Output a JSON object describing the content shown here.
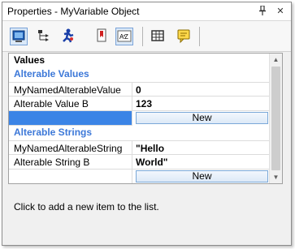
{
  "window": {
    "title": "Properties - MyVariable Object",
    "pin_glyph": "ᵽ",
    "close_glyph": "✕"
  },
  "toolbar": {
    "tools": [
      {
        "name": "properties-icon",
        "active": true
      },
      {
        "name": "hierarchy-icon",
        "active": false
      },
      {
        "name": "run-icon",
        "active": false
      },
      {
        "name": "bookmark-icon",
        "active": false
      },
      {
        "name": "sort-alpha-icon",
        "active": true,
        "label": "AZ"
      },
      {
        "name": "grid-icon",
        "active": false
      },
      {
        "name": "comment-icon",
        "active": false
      }
    ]
  },
  "grid": {
    "top_category": "Values",
    "sections": [
      {
        "title": "Alterable Values",
        "rows": [
          {
            "name": "MyNamedAlterableValue",
            "value": "0"
          },
          {
            "name": "Alterable Value B",
            "value": "123"
          }
        ],
        "new_button": "New"
      },
      {
        "title": "Alterable Strings",
        "rows": [
          {
            "name": "MyNamedAlterableString",
            "value": "\"Hello"
          },
          {
            "name": "Alterable String B",
            "value": "World\""
          }
        ],
        "new_button": "New"
      }
    ]
  },
  "description": {
    "text": "Click to add a new item to the list."
  },
  "colors": {
    "accent": "#3c78d8",
    "selection": "#3b84e6"
  }
}
